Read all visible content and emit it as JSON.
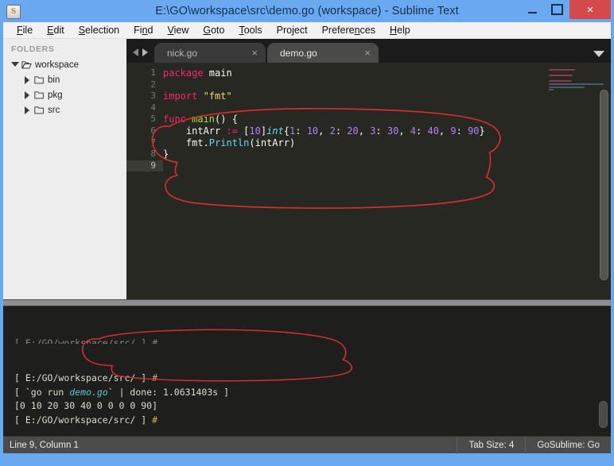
{
  "window": {
    "title": "E:\\GO\\workspace\\src\\demo.go (workspace) - Sublime Text",
    "app_icon": "S",
    "controls": {
      "minimize": "minimize-icon",
      "maximize": "maximize-icon",
      "close": "×"
    },
    "accent_color": "#6aa8f0",
    "close_color": "#d4494c"
  },
  "menubar": {
    "items": [
      {
        "pre": "",
        "key": "F",
        "post": "ile"
      },
      {
        "pre": "",
        "key": "E",
        "post": "dit"
      },
      {
        "pre": "",
        "key": "S",
        "post": "election"
      },
      {
        "pre": "Fi",
        "key": "n",
        "post": "d"
      },
      {
        "pre": "",
        "key": "V",
        "post": "iew"
      },
      {
        "pre": "",
        "key": "G",
        "post": "oto"
      },
      {
        "pre": "",
        "key": "T",
        "post": "ools"
      },
      {
        "pre": "Pro",
        "key": "j",
        "post": "ect"
      },
      {
        "pre": "Prefere",
        "key": "n",
        "post": "ces"
      },
      {
        "pre": "",
        "key": "H",
        "post": "elp"
      }
    ]
  },
  "sidebar": {
    "header": "FOLDERS",
    "tree": [
      {
        "label": "workspace",
        "level": 0,
        "state": "open",
        "icon": "folder-open-icon"
      },
      {
        "label": "bin",
        "level": 1,
        "state": "closed",
        "icon": "folder-icon"
      },
      {
        "label": "pkg",
        "level": 1,
        "state": "closed",
        "icon": "folder-icon"
      },
      {
        "label": "src",
        "level": 1,
        "state": "closed",
        "icon": "folder-icon"
      }
    ]
  },
  "tabs": {
    "nav_prev": "nav-left-icon",
    "nav_next": "nav-right-icon",
    "menu": "chevron-down-icon",
    "items": [
      {
        "label": "nick.go",
        "active": false,
        "close": "×"
      },
      {
        "label": "demo.go",
        "active": true,
        "close": "×"
      }
    ]
  },
  "editor": {
    "line_numbers": [
      "1",
      "2",
      "3",
      "4",
      "5",
      "6",
      "7",
      "8",
      "9"
    ],
    "current_line": 9,
    "code_lines": [
      [
        {
          "t": "package ",
          "c": "kw"
        },
        {
          "t": "main",
          "c": "pun"
        }
      ],
      [],
      [
        {
          "t": "import ",
          "c": "kw"
        },
        {
          "t": "\"fmt\"",
          "c": "str"
        }
      ],
      [],
      [
        {
          "t": "func ",
          "c": "kw"
        },
        {
          "t": "main",
          "c": "fn"
        },
        {
          "t": "() {",
          "c": "pun"
        }
      ],
      [
        {
          "t": "    intArr ",
          "c": "pun"
        },
        {
          "t": ":=",
          "c": "kw"
        },
        {
          "t": " [",
          "c": "pun"
        },
        {
          "t": "10",
          "c": "num"
        },
        {
          "t": "]",
          "c": "pun"
        },
        {
          "t": "int",
          "c": "typ"
        },
        {
          "t": "{",
          "c": "pun"
        },
        {
          "t": "1",
          "c": "num"
        },
        {
          "t": ": ",
          "c": "pun"
        },
        {
          "t": "10",
          "c": "num"
        },
        {
          "t": ", ",
          "c": "pun"
        },
        {
          "t": "2",
          "c": "num"
        },
        {
          "t": ": ",
          "c": "pun"
        },
        {
          "t": "20",
          "c": "num"
        },
        {
          "t": ", ",
          "c": "pun"
        },
        {
          "t": "3",
          "c": "num"
        },
        {
          "t": ": ",
          "c": "pun"
        },
        {
          "t": "30",
          "c": "num"
        },
        {
          "t": ", ",
          "c": "pun"
        },
        {
          "t": "4",
          "c": "num"
        },
        {
          "t": ": ",
          "c": "pun"
        },
        {
          "t": "40",
          "c": "num"
        },
        {
          "t": ", ",
          "c": "pun"
        },
        {
          "t": "9",
          "c": "num"
        },
        {
          "t": ": ",
          "c": "pun"
        },
        {
          "t": "90",
          "c": "num"
        },
        {
          "t": "}",
          "c": "pun"
        }
      ],
      [
        {
          "t": "    fmt.",
          "c": "pun"
        },
        {
          "t": "Println",
          "c": "call"
        },
        {
          "t": "(intArr)",
          "c": "pun"
        }
      ],
      [
        {
          "t": "}",
          "c": "pun"
        }
      ],
      []
    ],
    "background": "#272822"
  },
  "console": {
    "lines": [
      {
        "segments": [
          {
            "t": "[ ",
            "c": "cpath"
          },
          {
            "t": "E:/GO/workspace/src/",
            "c": "cpath"
          },
          {
            "t": " ] ",
            "c": "cpath"
          },
          {
            "t": "#",
            "c": "chash"
          }
        ]
      },
      {
        "segments": [
          {
            "t": "[ `",
            "c": "cpath"
          },
          {
            "t": "go run ",
            "c": "cpath"
          },
          {
            "t": "demo.go",
            "c": "cfile"
          },
          {
            "t": "` | done: 1.0631403s ]",
            "c": "cpath"
          }
        ]
      },
      {
        "segments": [
          {
            "t": "[0 10 20 30 40 0 0 0 0 90]",
            "c": "carr"
          }
        ]
      },
      {
        "segments": [
          {
            "t": "[ ",
            "c": "cpath"
          },
          {
            "t": "E:/GO/workspace/src/",
            "c": "cpath"
          },
          {
            "t": " ] ",
            "c": "cpath"
          },
          {
            "t": "#",
            "c": "chash"
          }
        ]
      }
    ]
  },
  "statusbar": {
    "position": "Line 9, Column 1",
    "tab_size": "Tab Size: 4",
    "syntax": "GoSublime: Go"
  },
  "annotations": {
    "color": "#d32f2f",
    "shapes": [
      "ellipse-around-line6-code",
      "ellipse-around-console-output"
    ]
  }
}
